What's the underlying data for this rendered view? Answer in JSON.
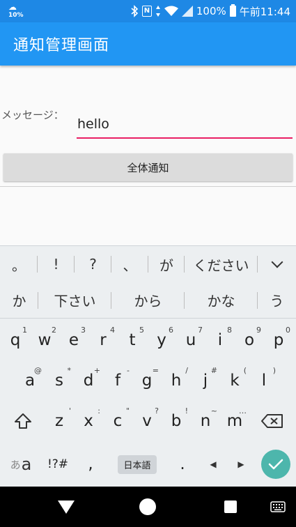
{
  "status_bar": {
    "weather_icon": "cloud-sun-icon",
    "weather_pct": "10%",
    "battery_pct": "100%",
    "time": "午前11:44"
  },
  "app_bar": {
    "title": "通知管理画面"
  },
  "form": {
    "message_label": "メッセージ：",
    "message_value": "hello",
    "notify_button": "全体通知"
  },
  "keyboard": {
    "suggestions_row1": [
      "。",
      "!",
      "?",
      "、",
      "が",
      "ください"
    ],
    "suggestions_row2": [
      "か",
      "下さい",
      "から",
      "かな",
      "う"
    ],
    "row1": [
      {
        "key": "q",
        "hint": "1"
      },
      {
        "key": "w",
        "hint": "2"
      },
      {
        "key": "e",
        "hint": "3"
      },
      {
        "key": "r",
        "hint": "4"
      },
      {
        "key": "t",
        "hint": "5"
      },
      {
        "key": "y",
        "hint": "6"
      },
      {
        "key": "u",
        "hint": "7"
      },
      {
        "key": "i",
        "hint": "8"
      },
      {
        "key": "o",
        "hint": "9"
      },
      {
        "key": "p",
        "hint": "0"
      }
    ],
    "row2": [
      {
        "key": "a",
        "hint": "@"
      },
      {
        "key": "s",
        "hint": "*"
      },
      {
        "key": "d",
        "hint": "+"
      },
      {
        "key": "f",
        "hint": "-"
      },
      {
        "key": "g",
        "hint": "="
      },
      {
        "key": "h",
        "hint": "/"
      },
      {
        "key": "j",
        "hint": "#"
      },
      {
        "key": "k",
        "hint": "("
      },
      {
        "key": "l",
        "hint": ")"
      }
    ],
    "row3": [
      {
        "key": "z",
        "hint": "'"
      },
      {
        "key": "x",
        "hint": ":"
      },
      {
        "key": "c",
        "hint": "\""
      },
      {
        "key": "v",
        "hint": "?"
      },
      {
        "key": "b",
        "hint": "!"
      },
      {
        "key": "n",
        "hint": "~"
      },
      {
        "key": "m",
        "hint": "…"
      }
    ],
    "bottom": {
      "kana_small": "あ",
      "kana_big": "a",
      "symbols": "!?#",
      "comma": ",",
      "language": "日本語",
      "period": "."
    },
    "accent_color": "#4db6ac"
  },
  "colors": {
    "status_bar": "#1e88e5",
    "app_bar": "#2196f3",
    "input_underline": "#e91e63"
  }
}
